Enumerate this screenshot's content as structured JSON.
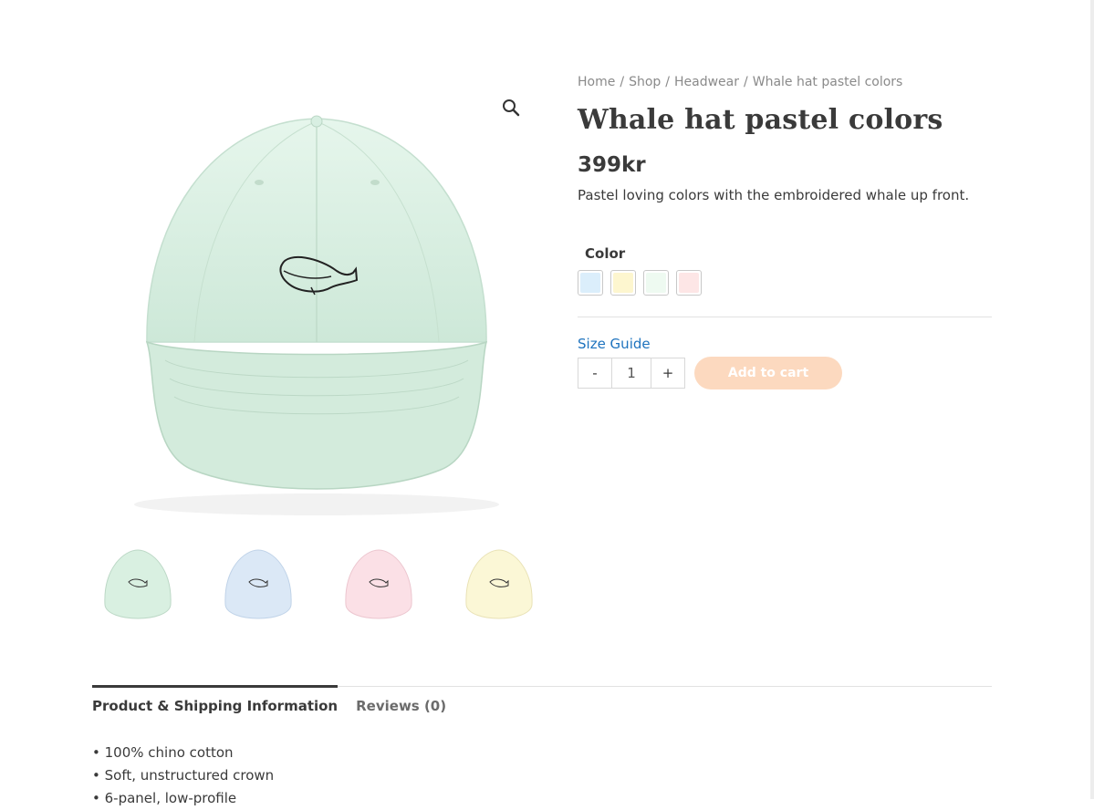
{
  "breadcrumb": {
    "home": "Home",
    "shop": "Shop",
    "category": "Headwear",
    "current": "Whale hat pastel colors",
    "separator": "/"
  },
  "product": {
    "title": "Whale hat pastel colors",
    "price": "399kr",
    "description": "Pastel loving colors with the embroidered whale up front."
  },
  "variations": {
    "color_label": "Color",
    "swatches": [
      {
        "color": "#dbeefb"
      },
      {
        "color": "#fdf6cf"
      },
      {
        "color": "#eefaf1"
      },
      {
        "color": "#fde6e6"
      }
    ]
  },
  "cart": {
    "size_guide": "Size Guide",
    "minus": "-",
    "plus": "+",
    "quantity": "1",
    "add_to_cart": "Add to cart"
  },
  "gallery": {
    "zoom_icon": "magnifier-icon",
    "main_color": "#ddf2e6",
    "thumbs": [
      {
        "color": "#d9f0e1"
      },
      {
        "color": "#dbe8f6"
      },
      {
        "color": "#fbe0e6"
      },
      {
        "color": "#fbf7d6"
      }
    ]
  },
  "tabs": {
    "product_info": "Product & Shipping Information",
    "reviews": "Reviews (0)"
  },
  "details": [
    "• 100% chino cotton",
    "• Soft, unstructured crown",
    "• 6-panel, low-profile"
  ]
}
